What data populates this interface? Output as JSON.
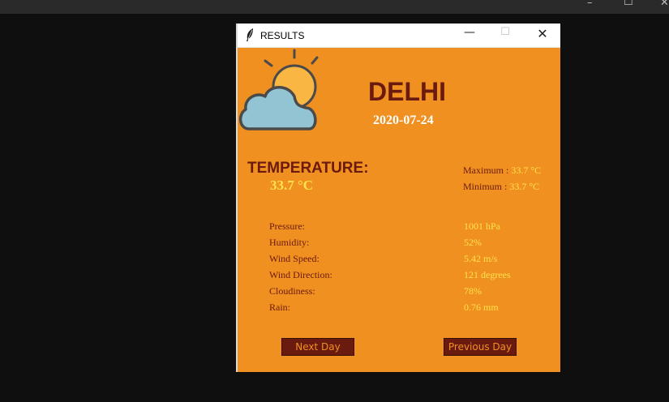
{
  "window": {
    "title": "RESULTS"
  },
  "weather": {
    "city": "DELHI",
    "date": "2020-07-24",
    "temperature_label": "TEMPERATURE:",
    "temperature_value": "33.7 °C",
    "maximum_label": "Maximum : ",
    "maximum_value": "33.7 °C",
    "minimum_label": "Minimum : ",
    "minimum_value": "33.7 °C",
    "details": [
      {
        "label": "Pressure:",
        "value": "1001 hPa"
      },
      {
        "label": "Humidity:",
        "value": "52%"
      },
      {
        "label": "Wind Speed:",
        "value": "5.42 m/s"
      },
      {
        "label": "Wind Direction:",
        "value": "121 degrees"
      },
      {
        "label": "Cloudiness:",
        "value": "78%"
      },
      {
        "label": "Rain:",
        "value": "0.76 mm"
      }
    ]
  },
  "buttons": {
    "next": "Next Day",
    "previous": "Previous Day"
  },
  "icons": {
    "app": "feather-icon",
    "weather": "partly-cloudy-icon"
  },
  "colors": {
    "background": "#ef9020",
    "dark_text": "#6b1a10",
    "value_text": "#ffe34a"
  }
}
